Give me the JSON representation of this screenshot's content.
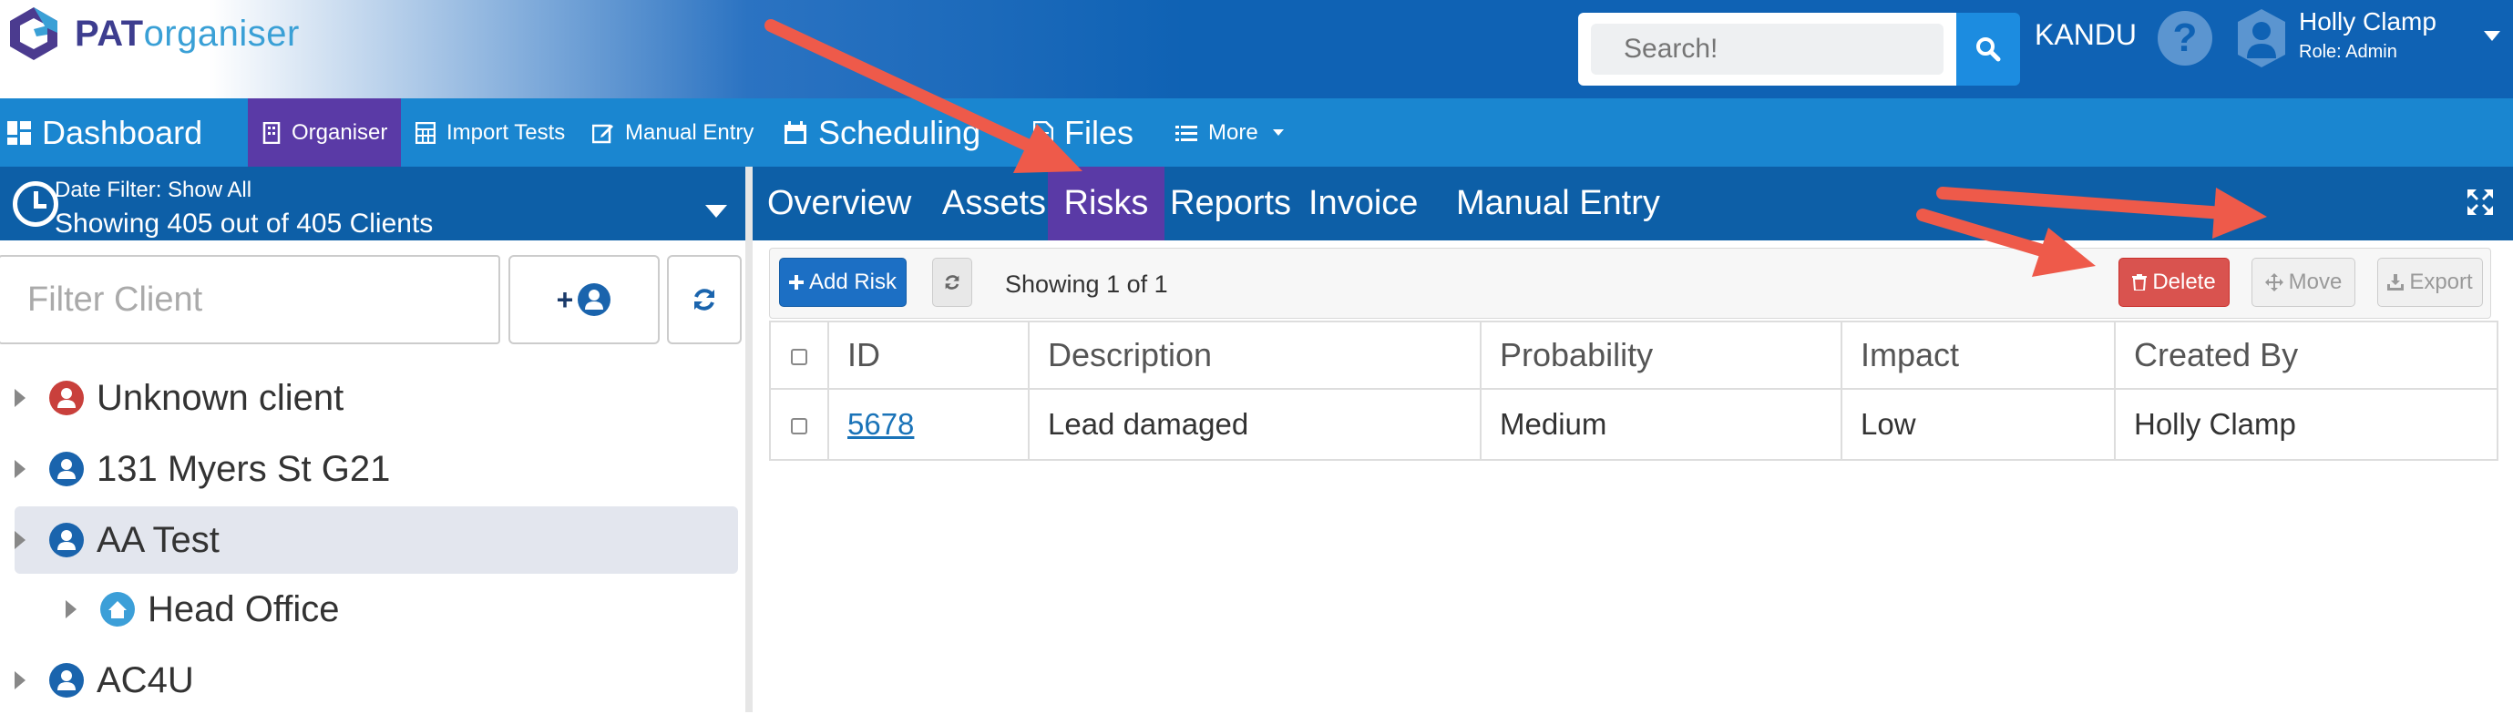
{
  "header": {
    "logo_text_pat": "PAT",
    "logo_text_org": "organiser",
    "search_placeholder": "Search!",
    "tenant": "KANDU",
    "user_name": "Holly Clamp",
    "user_role": "Role: Admin"
  },
  "nav": {
    "items": [
      {
        "label": "Dashboard",
        "icon": "dashboard-icon"
      },
      {
        "label": "Organiser",
        "icon": "building-icon",
        "active": true
      },
      {
        "label": "Import Tests",
        "icon": "calculator-icon"
      },
      {
        "label": "Manual Entry",
        "icon": "edit-icon"
      },
      {
        "label": "Scheduling",
        "icon": "calendar-icon"
      },
      {
        "label": "Files",
        "icon": "file-icon"
      },
      {
        "label": "More",
        "icon": "list-icon"
      }
    ]
  },
  "sidebar": {
    "date_filter": "Date Filter:  Show All",
    "showing_clients": "Showing 405 out of 405 Clients",
    "filter_placeholder": "Filter Client",
    "add_client_label": "+",
    "clients": [
      {
        "name": "Unknown client",
        "color": "#c9403c",
        "level": 0
      },
      {
        "name": "131 Myers St G21",
        "color": "#1a64ad",
        "level": 0
      },
      {
        "name": "AA Test",
        "color": "#1a64ad",
        "level": 0,
        "selected": true
      },
      {
        "name": "Head Office",
        "color": "#3c9fd8",
        "level": 1
      },
      {
        "name": "AC4U",
        "color": "#1a64ad",
        "level": 0
      }
    ]
  },
  "tabs": [
    {
      "label": "Overview"
    },
    {
      "label": "Assets"
    },
    {
      "label": "Risks",
      "active": true
    },
    {
      "label": "Reports"
    },
    {
      "label": "Invoice"
    },
    {
      "label": "Manual Entry"
    }
  ],
  "toolbar": {
    "add_label": "Add Risk",
    "showing": "Showing 1 of 1",
    "delete_label": "Delete",
    "move_label": "Move",
    "export_label": "Export"
  },
  "table": {
    "headers": [
      "ID",
      "Description",
      "Probability",
      "Impact",
      "Created By"
    ],
    "rows": [
      {
        "id": "5678",
        "description": "Lead damaged",
        "probability": "Medium",
        "impact": "Low",
        "created_by": "Holly Clamp"
      }
    ]
  },
  "colors": {
    "accent": "#1a86d0",
    "active_tab": "#5a3aa6",
    "annotation_arrow": "#ee5a4a",
    "delete": "#d9534f"
  }
}
